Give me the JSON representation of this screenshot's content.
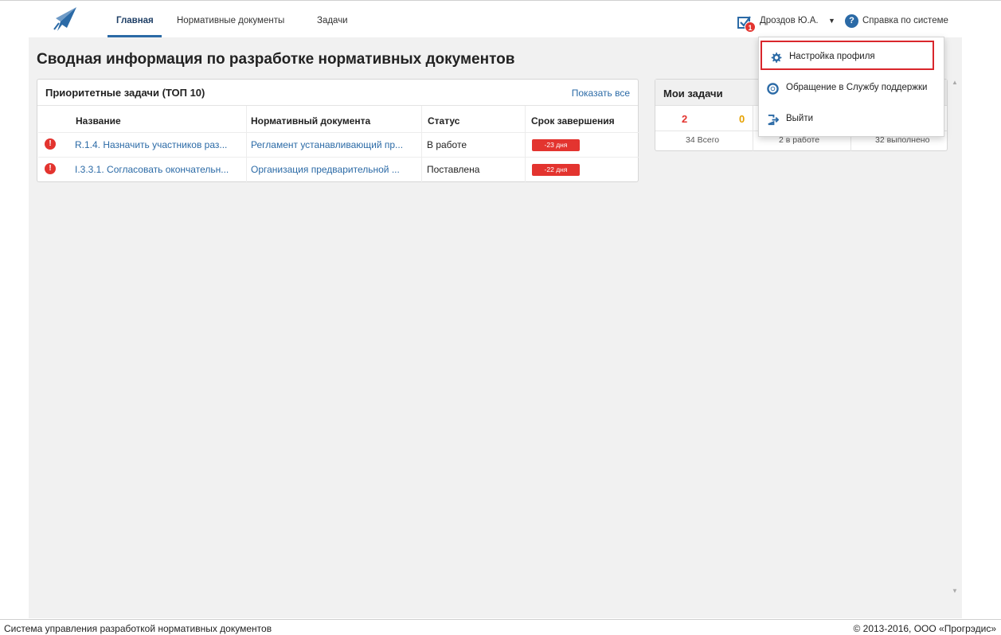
{
  "nav": {
    "items": [
      {
        "label": "Главная",
        "active": true
      },
      {
        "label": "Нормативные документы",
        "active": false
      },
      {
        "label": "Задачи",
        "active": false
      }
    ]
  },
  "user": {
    "name": "Дроздов Ю.А.",
    "notification_count": "1"
  },
  "help": {
    "label": "Справка по системе"
  },
  "page": {
    "title": "Сводная информация по разработке нормативных документов"
  },
  "priority_panel": {
    "title": "Приоритетные задачи (ТОП 10)",
    "show_all": "Показать все",
    "columns": [
      "Название",
      "Нормативный документа",
      "Статус",
      "Срок завершения"
    ],
    "rows": [
      {
        "name": "R.1.4. Назначить участников раз...",
        "document": "Регламент устанавливающий пр...",
        "status": "В работе",
        "deadline": "-23 дня"
      },
      {
        "name": "I.3.3.1. Согласовать окончательн...",
        "document": "Организация предварительной ...",
        "status": "Поставлена",
        "deadline": "-22 дня"
      }
    ]
  },
  "my_tasks": {
    "title": "Мои задачи",
    "counts": [
      {
        "value": "2",
        "color": "#e3342f"
      },
      {
        "value": "0",
        "color": "#e6a100"
      }
    ],
    "labels": [
      "34 Всего",
      "2 в работе",
      "32 выполнено"
    ]
  },
  "dropdown": {
    "items": [
      {
        "label": "Настройка профиля",
        "icon": "gear-icon"
      },
      {
        "label": "Обращение в Службу поддержки",
        "icon": "lifebuoy-icon"
      },
      {
        "label": "Выйти",
        "icon": "logout-icon"
      }
    ]
  },
  "footer": {
    "left": "Система управления разработкой нормативных документов",
    "right": "© 2013-2016, ООО «Прогрэдис»"
  },
  "colors": {
    "accent": "#2b6aa6",
    "danger": "#e3342f",
    "warning": "#e6a100"
  }
}
